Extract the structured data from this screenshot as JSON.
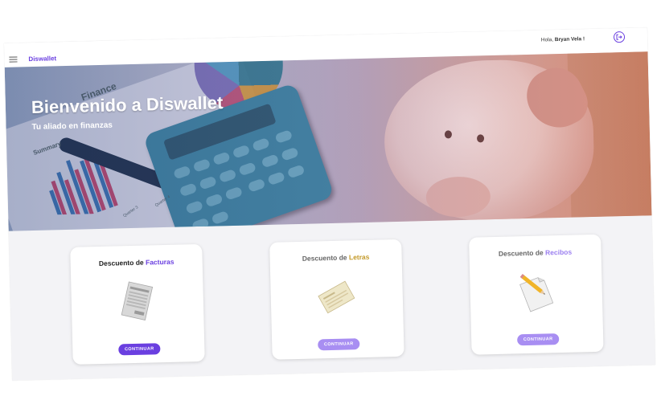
{
  "header": {
    "brand": "Diswallet",
    "greeting_prefix": "Hola,",
    "user_name": "Bryan Vela !"
  },
  "hero": {
    "title": "Bienvenido a Diswallet",
    "subtitle": "Tu aliado en finanzas",
    "image_text": [
      "Finance",
      "Summary",
      "Quarter 3",
      "Quarter 4"
    ]
  },
  "cards": [
    {
      "title_prefix": "Descuento de",
      "title_accent": "Facturas",
      "button": "CONTINUAR",
      "icon": "invoice-document-icon"
    },
    {
      "title_prefix": "Descuento de",
      "title_accent": "Letras",
      "button": "CONTINUAR",
      "icon": "bill-check-icon"
    },
    {
      "title_prefix": "Descuento de",
      "title_accent": "Recibos",
      "button": "CONTINUAR",
      "icon": "receipt-pencil-icon"
    }
  ],
  "colors": {
    "accent": "#6a3fe0",
    "accent_light": "#a88ef2",
    "background": "#f3f3f6"
  }
}
